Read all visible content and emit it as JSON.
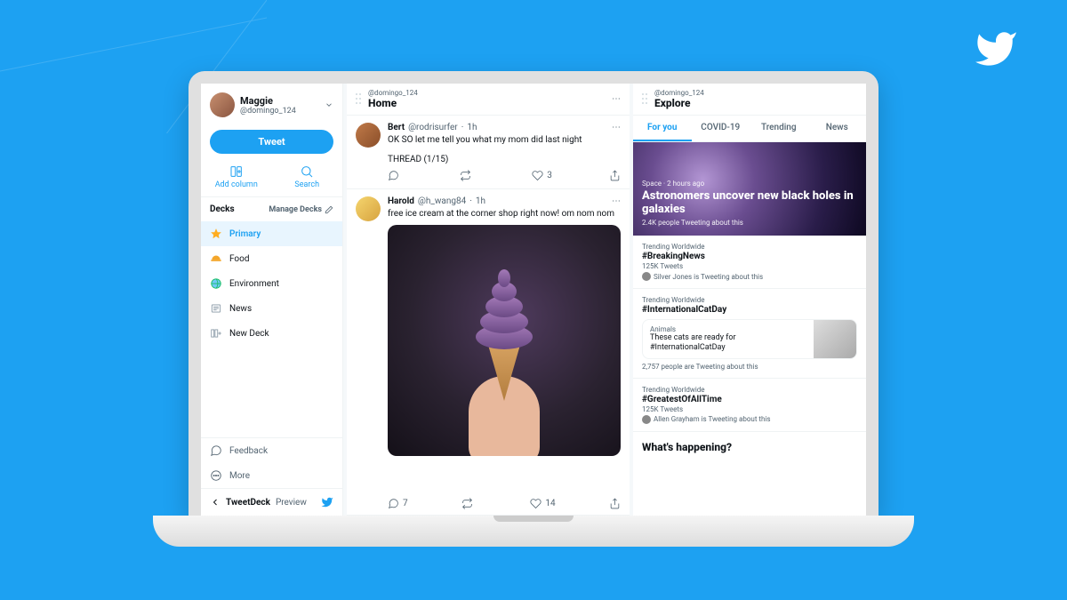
{
  "sidebar": {
    "user": {
      "name": "Maggie",
      "handle": "@domingo_124"
    },
    "tweet_button": "Tweet",
    "actions": {
      "add_column": "Add column",
      "search": "Search"
    },
    "decks_label": "Decks",
    "manage_decks": "Manage Decks",
    "decks": [
      {
        "label": "Primary"
      },
      {
        "label": "Food"
      },
      {
        "label": "Environment"
      },
      {
        "label": "News"
      },
      {
        "label": "New Deck"
      }
    ],
    "footer": {
      "feedback": "Feedback",
      "more": "More"
    },
    "branding": {
      "name": "TweetDeck",
      "suffix": "Preview"
    }
  },
  "home": {
    "handle": "@domingo_124",
    "title": "Home",
    "tweets": [
      {
        "author": "Bert",
        "handle": "@rodrisurfer",
        "time": "1h",
        "text": "OK SO let me tell you what my mom did last night",
        "thread": "THREAD (1/15)",
        "replies": "",
        "retweets": "",
        "likes": "3"
      },
      {
        "author": "Harold",
        "handle": "@h_wang84",
        "time": "1h",
        "text": "free ice cream at the corner shop right now! om nom nom",
        "replies": "7",
        "retweets": "",
        "likes": "14"
      }
    ]
  },
  "explore": {
    "handle": "@domingo_124",
    "title": "Explore",
    "tabs": [
      "For you",
      "COVID-19",
      "Trending",
      "News"
    ],
    "hero": {
      "meta": "Space · 2 hours ago",
      "title": "Astronomers uncover new black holes in galaxies",
      "sub": "2.4K people Tweeting about this"
    },
    "trends": [
      {
        "meta": "Trending Worldwide",
        "name": "#BreakingNews",
        "tweets": "125K Tweets",
        "who": "Silver Jones is Tweeting about this"
      },
      {
        "meta": "Trending Worldwide",
        "name": "#InternationalCatDay",
        "card_cat": "Animals",
        "card_title": "These cats are ready for #InternationalCatDay",
        "sub": "2,757 people are Tweeting about this"
      },
      {
        "meta": "Trending Worldwide",
        "name": "#GreatestOfAllTime",
        "tweets": "125K Tweets",
        "who": "Allen Grayham is Tweeting about this"
      }
    ],
    "whats_happening": "What's happening?"
  }
}
